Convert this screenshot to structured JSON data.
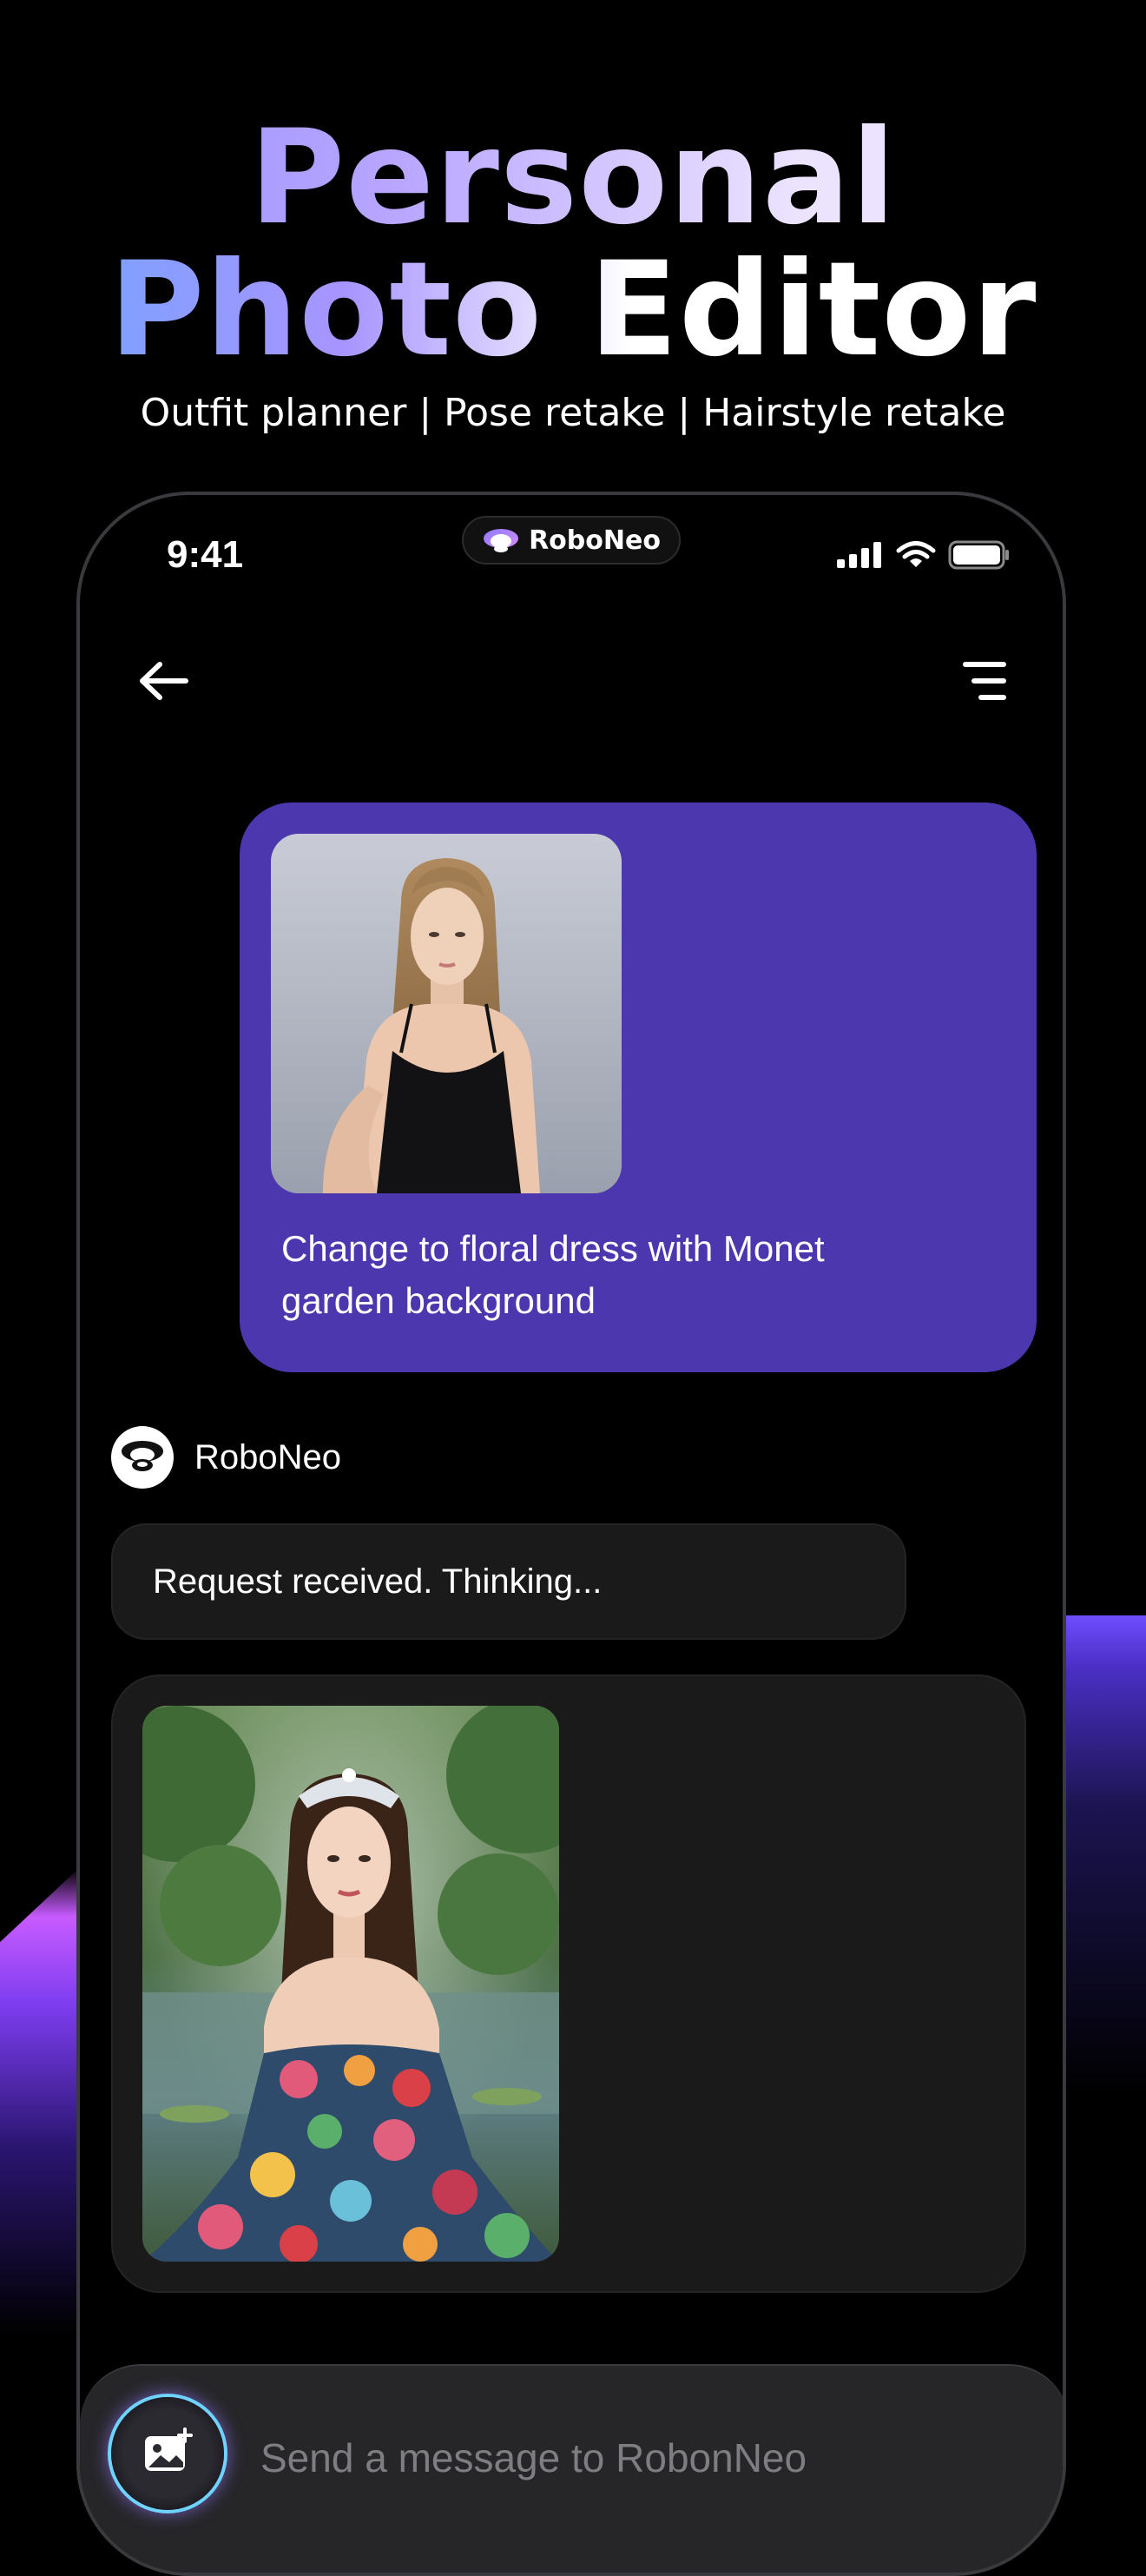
{
  "promo": {
    "headline_line1": "Personal",
    "headline_line2": "Photo Editor",
    "subtitle": "Outfit planner | Pose retake | Hairstyle retake"
  },
  "status_bar": {
    "time": "9:41",
    "island_label": "RoboNeo"
  },
  "chat": {
    "user_message": "Change to floral dress with Monet garden background",
    "bot_name": "RoboNeo",
    "bot_status": "Request received. Thinking..."
  },
  "composer": {
    "placeholder": "Send a message to RobonNeo"
  },
  "icons": {
    "back": "arrow-left-icon",
    "menu": "menu-icon",
    "image_upload": "image-plus-icon",
    "signal": "signal-icon",
    "wifi": "wifi-icon",
    "battery": "battery-icon"
  },
  "colors": {
    "background": "#000000",
    "user_bubble": "#4c37ae",
    "bot_bubble": "#1a1a1a",
    "composer": "#262629",
    "accent_glow": "#6fd3ff"
  }
}
